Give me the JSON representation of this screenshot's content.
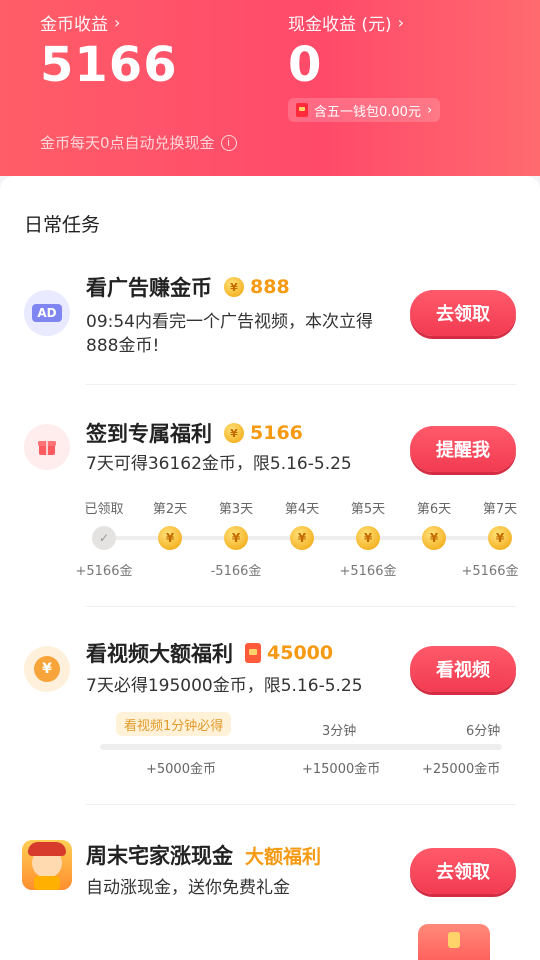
{
  "header": {
    "coin_income_label": "金币收益",
    "coin_income_value": "5166",
    "cash_income_label": "现金收益 (元)",
    "cash_income_value": "0",
    "wallet_pill": "含五一钱包0.00元",
    "note": "金币每天0点自动兑换现金"
  },
  "section_title": "日常任务",
  "tasks": {
    "ad": {
      "icon_label": "AD",
      "title": "看广告赚金币",
      "reward": "888",
      "desc_line1": "09:54内看完一个广告视频，本次立得",
      "desc_line2": "888金币!",
      "button": "去领取"
    },
    "checkin": {
      "title": "签到专属福利",
      "reward": "5166",
      "desc": "7天可得36162金币，限5.16-5.25",
      "button": "提醒我",
      "days": [
        {
          "label": "已领取",
          "claimed": true
        },
        {
          "label": "第2天",
          "claimed": false
        },
        {
          "label": "第3天",
          "claimed": false
        },
        {
          "label": "第4天",
          "claimed": false
        },
        {
          "label": "第5天",
          "claimed": false
        },
        {
          "label": "第6天",
          "claimed": false
        },
        {
          "label": "第7天",
          "claimed": false
        }
      ],
      "day_rewards": [
        "+5166金",
        "-5166金",
        "+5166金",
        "+5166金"
      ]
    },
    "video": {
      "icon_symbol": "¥",
      "title": "看视频大额福利",
      "reward": "45000",
      "desc": "7天必得195000金币，限5.16-5.25",
      "button": "看视频",
      "progress_tag": "看视频1分钟必得",
      "milestones": [
        "3分钟",
        "6分钟"
      ],
      "rewards": [
        "+5000金币",
        "+15000金币",
        "+25000金币"
      ]
    },
    "weekend": {
      "title": "周末宅家涨现金",
      "tag": "大额福利",
      "desc": "自动涨现金，送你免费礼金",
      "button": "去领取"
    }
  },
  "colors": {
    "header_gradient_start": "#ff5d68",
    "header_gradient_end": "#ff6a6f",
    "accent_red": "#f23b52",
    "coin_gold": "#f5b52a",
    "reward_orange": "#f59a12"
  }
}
